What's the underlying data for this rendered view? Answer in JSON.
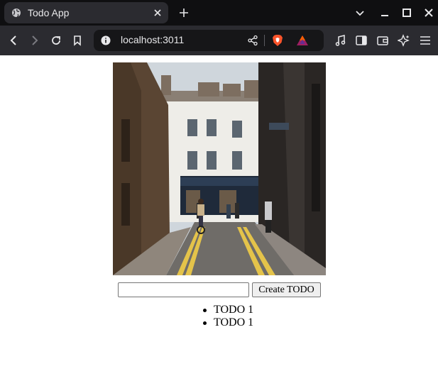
{
  "browser": {
    "tab": {
      "title": "Todo App",
      "favicon": "globe-icon"
    },
    "url": "localhost:3011",
    "icons": [
      "back-icon",
      "forward-icon",
      "reload-icon",
      "bookmark-icon",
      "site-info-icon",
      "share-icon",
      "brave-shields-icon",
      "brave-rewards-icon",
      "media-icon",
      "sidebar-icon",
      "wallet-icon",
      "leo-ai-icon",
      "menu-icon"
    ],
    "colors": {
      "tabbar": "#0f0f11",
      "toolbar": "#2b2b30",
      "urlbar": "#161618",
      "brave_orange": "#fb542b"
    }
  },
  "page": {
    "image": {
      "subject": "narrow city street with brick buildings, cyclist and pedestrians"
    },
    "input": {
      "value": "",
      "placeholder": ""
    },
    "create_button_label": "Create TODO",
    "todos": [
      {
        "text": "TODO 1"
      },
      {
        "text": "TODO 1"
      }
    ]
  }
}
